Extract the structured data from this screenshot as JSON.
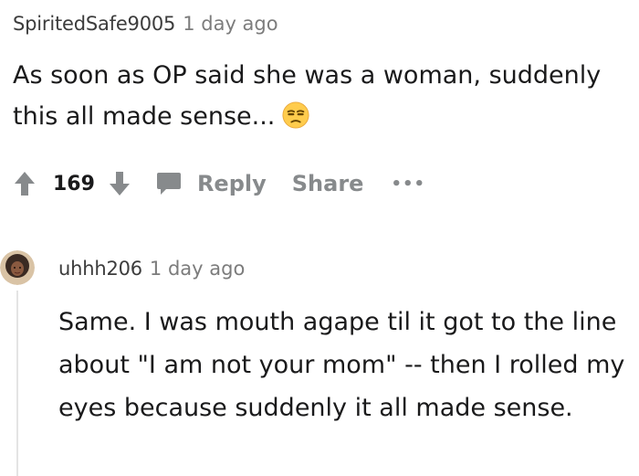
{
  "comment": {
    "author": "SpiritedSafe9005",
    "time": "1 day ago",
    "body": "As soon as OP said she was a woman, suddenly this all made sense...",
    "emoji_icon": "unamused-face-icon",
    "vote_count": "169",
    "actions": {
      "reply": "Reply",
      "share": "Share",
      "more": "•••"
    }
  },
  "reply": {
    "author": "uhhh206",
    "time": "1 day ago",
    "body": "Same. I was mouth agape til it got to the line about \"I am not your mom\" -- then I rolled my eyes because suddenly it all made sense."
  },
  "colors": {
    "text": "#1a1a1b",
    "meta": "#7c7c7c",
    "action": "#878a8c",
    "thread_line": "#e4e4e4"
  }
}
